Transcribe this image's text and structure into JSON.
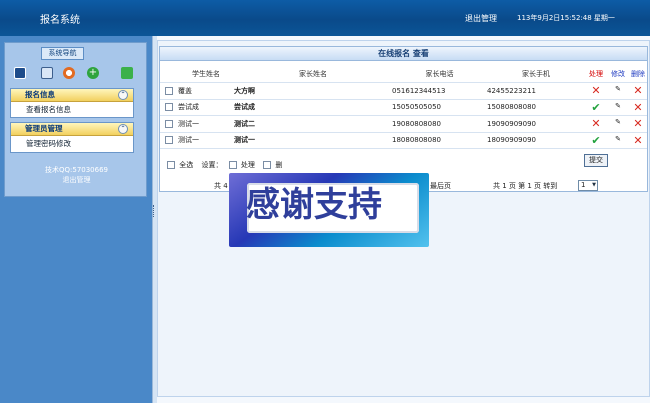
{
  "header": {
    "app_title": "报名系统",
    "logout": "退出管理",
    "datetime": "113年9月2日15:52:48 星期一"
  },
  "sidebar": {
    "nav_title": "系统导航",
    "groups": [
      {
        "title": "报名信息",
        "items": [
          "查看报名信息"
        ]
      },
      {
        "title": "管理员管理",
        "items": [
          "管理密码修改"
        ]
      }
    ],
    "contact": "技术QQ:57030669",
    "logout": "退出管理"
  },
  "panel": {
    "title": "在线报名 查看",
    "columns": [
      "学生姓名",
      "家长姓名",
      "家长电话",
      "家长手机",
      "处理",
      "修改",
      "删除"
    ],
    "rows": [
      {
        "student": "覆盖",
        "parent": "大方啊",
        "phone": "051612344513",
        "mobile": "42455223211",
        "status": "x"
      },
      {
        "student": "尝试成",
        "parent": "尝试成",
        "phone": "15050505050",
        "mobile": "15080808080",
        "status": "check"
      },
      {
        "student": "测试一",
        "parent": "测试二",
        "phone": "19080808080",
        "mobile": "19090909090",
        "status": "x"
      },
      {
        "student": "测试一",
        "parent": "测试一",
        "phone": "18080808080",
        "mobile": "18090909090",
        "status": "check"
      }
    ],
    "select_all": "全选",
    "settings_label": "设置：",
    "option_process": "处理",
    "option_delete": "删",
    "submit": "提交",
    "pager_left": "共 4",
    "pager_last": "最后页",
    "pager_info": "共 1 页 第 1 页 转到",
    "page_value": "1"
  },
  "banner": {
    "text": "感谢支持"
  },
  "colors": {
    "header": "#0a4a8a",
    "sidebar": "#a7c6ea",
    "accent": "#d40000"
  }
}
